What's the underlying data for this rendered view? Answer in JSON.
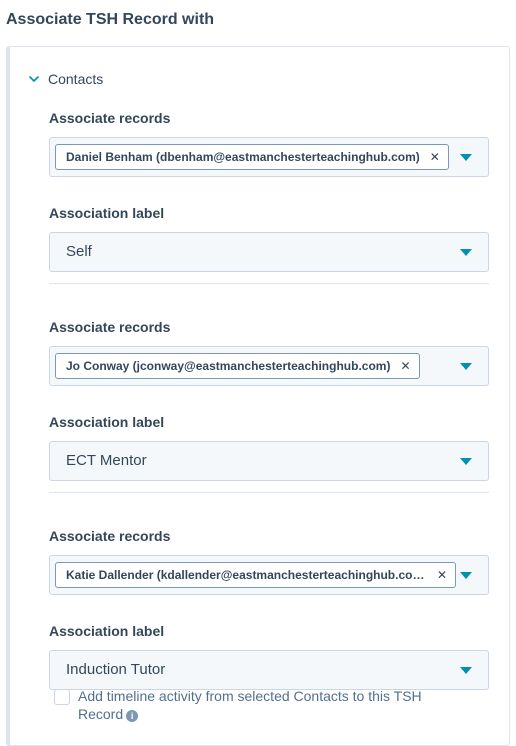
{
  "page": {
    "title": "Associate TSH Record with"
  },
  "section": {
    "label": "Contacts"
  },
  "associations": [
    {
      "records_label": "Associate records",
      "record_tag": "Daniel Benham (dbenham@eastmanchesterteachinghub.com)",
      "label_heading": "Association label",
      "label_value": "Self"
    },
    {
      "records_label": "Associate records",
      "record_tag": "Jo Conway (jconway@eastmanchesterteachinghub.com)",
      "label_heading": "Association label",
      "label_value": "ECT Mentor"
    },
    {
      "records_label": "Associate records",
      "record_tag": "Katie Dallender (kdallender@eastmanchesterteachinghub.com)",
      "label_heading": "Association label",
      "label_value": "Induction Tutor"
    }
  ],
  "timeline": {
    "checked": false,
    "text": "Add timeline activity from selected Contacts to this TSH Record"
  },
  "icons": {
    "section_toggle": "chevron-down-icon",
    "tag_remove": "close-icon",
    "dropdown": "caret-down-icon",
    "help": "info-icon"
  },
  "colors": {
    "text": "#33475b",
    "accent": "#0091ae",
    "border": "#cbd6e2",
    "field_bg": "#f5f8fa"
  }
}
